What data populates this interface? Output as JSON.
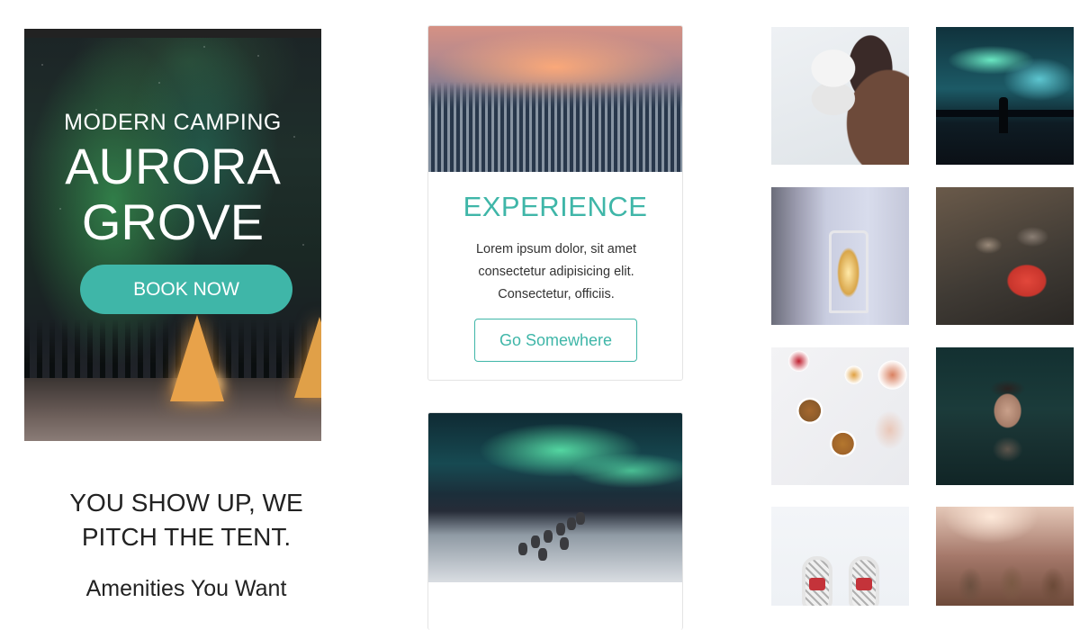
{
  "hero": {
    "subtitle": "MODERN CAMPING",
    "title_line1": "AURORA",
    "title_line2": "GROVE",
    "cta_label": "BOOK NOW"
  },
  "intro": {
    "tagline_line1": "YOU SHOW UP, WE",
    "tagline_line2": "PITCH THE TENT.",
    "amenities_heading": "Amenities You Want"
  },
  "experience_card": {
    "title": "EXPERIENCE",
    "text_line1": "Lorem ipsum dolor, sit amet",
    "text_line2": "consectetur adipisicing elit.",
    "text_line3": "Consectetur, officiis.",
    "button_label": "Go Somewhere"
  },
  "colors": {
    "accent": "#3fb6a8",
    "text": "#222222",
    "card_border": "#e4e4e4"
  },
  "gallery": [
    "husky-puppy-photo",
    "aurora-silhouette-photo",
    "snow-lantern-photo",
    "campfire-kettle-photo",
    "breakfast-bowls-photo",
    "hot-spring-face-photo",
    "snowshoes-photo",
    "sled-huskies-photo"
  ]
}
